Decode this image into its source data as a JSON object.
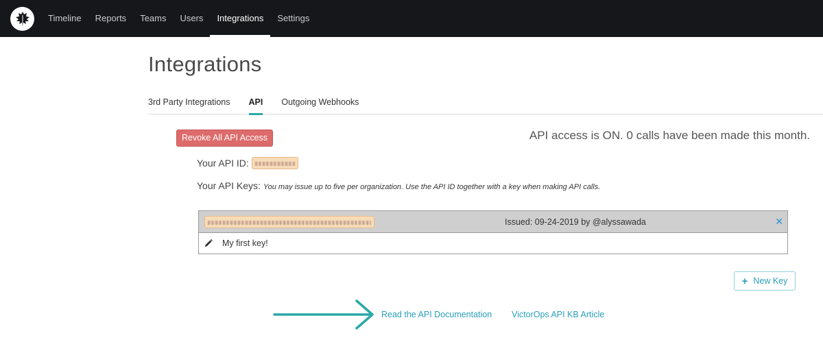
{
  "nav": {
    "logo_icon": "leaf-logo-icon",
    "items": [
      {
        "label": "Timeline"
      },
      {
        "label": "Reports"
      },
      {
        "label": "Teams"
      },
      {
        "label": "Users"
      },
      {
        "label": "Integrations",
        "active": true
      },
      {
        "label": "Settings"
      }
    ]
  },
  "page": {
    "title": "Integrations"
  },
  "tabs": [
    {
      "label": "3rd Party Integrations"
    },
    {
      "label": "API",
      "active": true
    },
    {
      "label": "Outgoing Webhooks"
    }
  ],
  "api": {
    "revoke_label": "Revoke All API Access",
    "status_text": "API access is ON. 0 calls have been made this month.",
    "id_label": "Your API ID:",
    "keys_label": "Your API Keys:",
    "keys_note": "You may issue up to five per organization. Use the API ID together with a key when making API calls.",
    "keys": [
      {
        "issued": "Issued: 09-24-2019 by @alyssawada",
        "description": "My first key!",
        "delete_icon": "close-icon",
        "edit_icon": "pencil-icon"
      }
    ],
    "new_key_label": "New Key",
    "new_key_icon": "plus-icon"
  },
  "links": {
    "docs": "Read the API Documentation",
    "kb": "VictorOps API KB Article"
  },
  "colors": {
    "nav_bg": "#16171a",
    "accent_teal": "#2aa8a6",
    "danger": "#dd6b6b",
    "link": "#2a9fb8"
  }
}
